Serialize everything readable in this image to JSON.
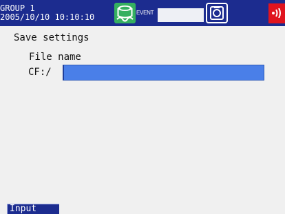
{
  "header": {
    "group": "GROUP 1",
    "datetime": "2005/10/10 10:10:10",
    "event_label": "EVENT",
    "event_value": "",
    "icons": [
      "disk-icon",
      "camera-icon",
      "alarm-icon"
    ],
    "colors": {
      "bar": "#1c2c8f",
      "disk": "#35b060",
      "alarm": "#e0141e"
    }
  },
  "main": {
    "title": "Save settings",
    "file_name_label": "File name",
    "path_label": "CF:/",
    "file_name_value": "",
    "input_color": "#4a7fe8"
  },
  "softkeys": {
    "input_label": "Input"
  }
}
